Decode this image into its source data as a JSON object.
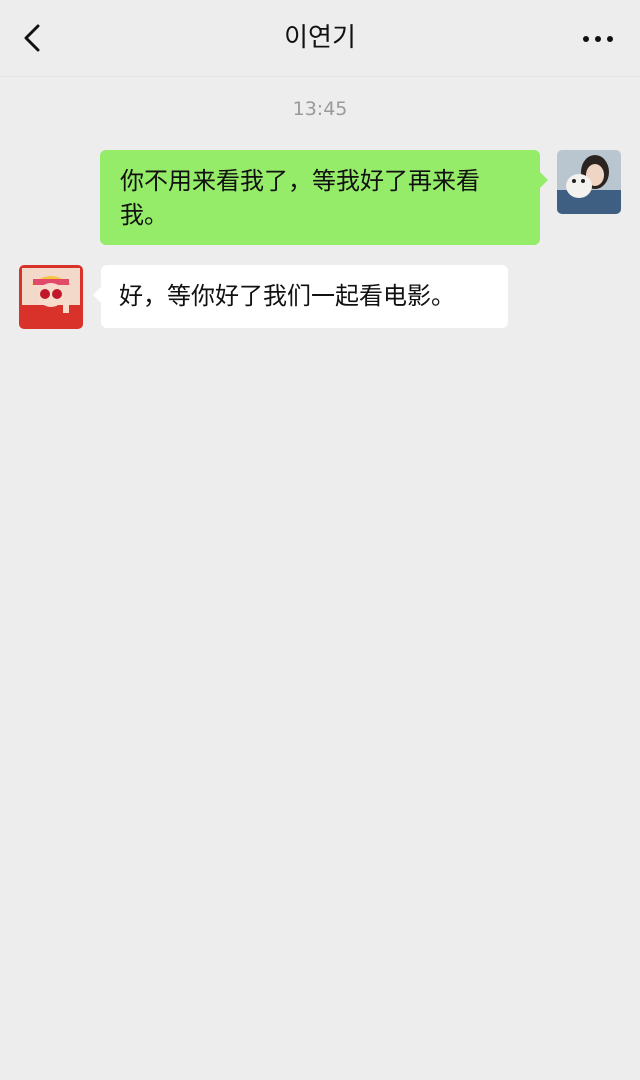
{
  "header": {
    "title": "이연기",
    "back_icon": "chevron-left-icon",
    "more_icon": "more-dots-icon"
  },
  "chat": {
    "timestamp": "13:45",
    "messages": [
      {
        "direction": "outgoing",
        "text": "你不用来看我了，等我好了再来看我。",
        "bubble_color": "#95ec69"
      },
      {
        "direction": "incoming",
        "text": "好，等你好了我们一起看电影。",
        "bubble_color": "#ffffff"
      }
    ]
  },
  "colors": {
    "background": "#ededed",
    "outgoing_bubble": "#95ec69",
    "incoming_bubble": "#ffffff",
    "timestamp": "#9a9a9a"
  }
}
